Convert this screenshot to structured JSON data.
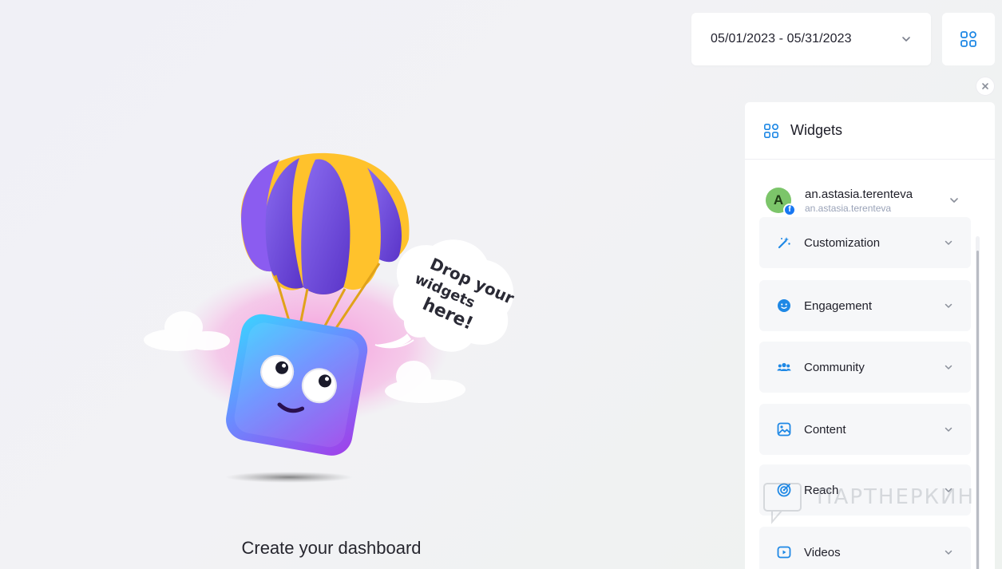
{
  "date_range": {
    "value": "05/01/2023 - 05/31/2023",
    "icon": "chevron-down-icon"
  },
  "toolbar": {
    "widgets_toggle_icon": "grid-icon",
    "close_icon": "close-icon"
  },
  "illustration": {
    "speech_bubble": "Drop your widgets here!",
    "caption": "Create your dashboard"
  },
  "panel": {
    "title": "Widgets",
    "icon": "grid-icon",
    "account": {
      "avatar_letter": "A",
      "name": "an.astasia.terenteva",
      "subtitle": "an.astasia.terenteva",
      "network_badge": "f",
      "network": "facebook"
    },
    "categories": [
      {
        "label": "Customization",
        "icon": "magic-wand-icon"
      },
      {
        "label": "Engagement",
        "icon": "smile-icon"
      },
      {
        "label": "Community",
        "icon": "people-icon"
      },
      {
        "label": "Content",
        "icon": "image-icon"
      },
      {
        "label": "Reach",
        "icon": "target-icon"
      },
      {
        "label": "Videos",
        "icon": "play-icon"
      }
    ]
  },
  "watermark": {
    "text": "ПАРТНЕРКИН"
  },
  "colors": {
    "accent": "#1e88e5",
    "panel_bg": "#ffffff",
    "category_bg": "#f6f7f9"
  }
}
